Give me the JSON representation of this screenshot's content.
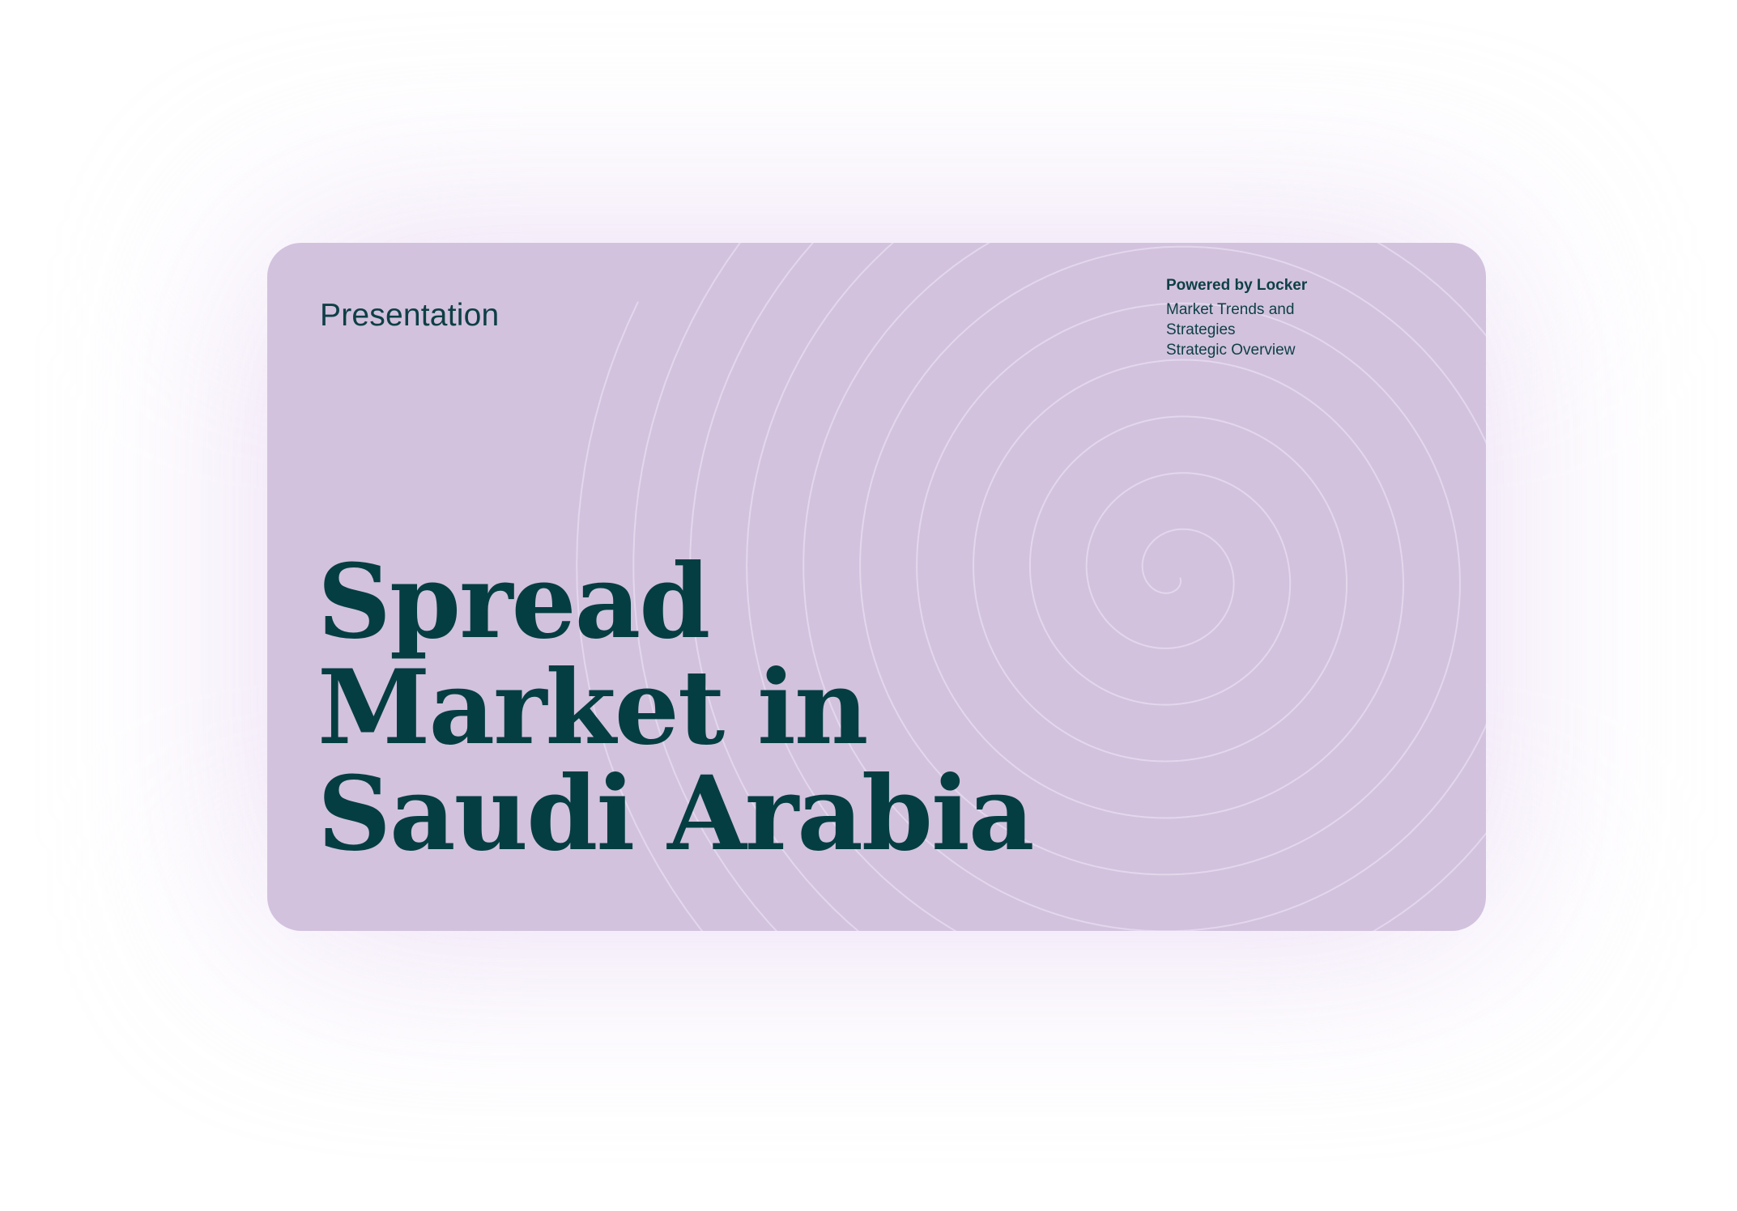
{
  "slide": {
    "eyebrow": "Presentation",
    "powered_by": "Powered by Locker",
    "subtitle_line_1": "Market Trends and Strategies",
    "subtitle_line_2": "Strategic Overview",
    "headline_line_1": "Spread",
    "headline_line_2": "Market in",
    "headline_line_3": "Saudi Arabia"
  },
  "colors": {
    "card_background": "#d2c2de",
    "text": "#0e3f46",
    "headline": "#053e42",
    "glow": "#e6d4f2",
    "spiral_stroke": "#e6dbee"
  },
  "decoration": {
    "icon": "spiral-pattern"
  }
}
